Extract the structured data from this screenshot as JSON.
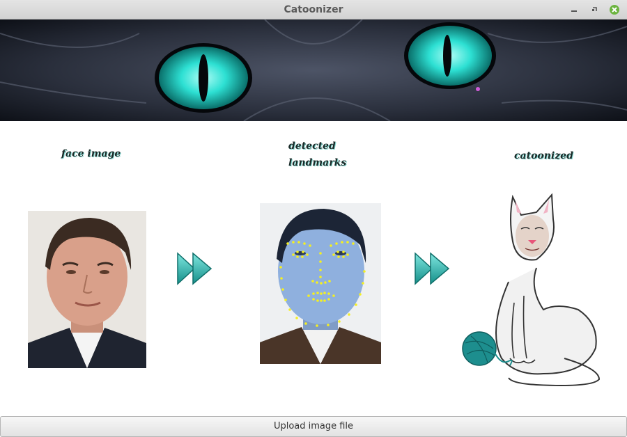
{
  "window": {
    "title": "Catoonizer"
  },
  "panels": {
    "face_caption": "face image",
    "landmarks_caption_line1": "detected",
    "landmarks_caption_line2": "landmarks",
    "cat_caption": "catoonized"
  },
  "colors": {
    "accent": "#2bb7b5",
    "landmark_dot": "#f5f020",
    "close_button": "#6cb43f"
  },
  "icons": [
    "minimize-icon",
    "restore-icon",
    "close-icon",
    "fast-forward-icon"
  ],
  "actions": {
    "upload_label": "Upload image file"
  }
}
